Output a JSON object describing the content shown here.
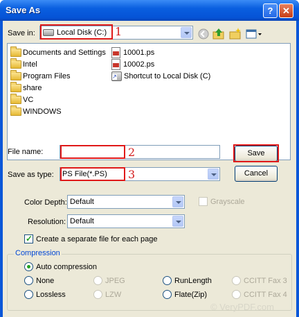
{
  "window": {
    "title": "Save As",
    "help_glyph": "?",
    "close_glyph": "✕"
  },
  "save_in": {
    "label": "Save in:",
    "value": "Local Disk (C:)",
    "annotation": "1"
  },
  "files": [
    {
      "name": "Documents and Settings",
      "icon": "folder-icon"
    },
    {
      "name": "Intel",
      "icon": "folder-icon"
    },
    {
      "name": "Program Files",
      "icon": "folder-icon"
    },
    {
      "name": "share",
      "icon": "folder-icon"
    },
    {
      "name": "VC",
      "icon": "folder-icon"
    },
    {
      "name": "WINDOWS",
      "icon": "folder-icon"
    },
    {
      "name": "10001.ps",
      "icon": "ps-file-icon"
    },
    {
      "name": "10002.ps",
      "icon": "ps-file-icon"
    },
    {
      "name": "Shortcut to Local Disk (C)",
      "icon": "shortcut-icon"
    }
  ],
  "file_name": {
    "label": "File name:",
    "value": "",
    "annotation": "2"
  },
  "save_as_type": {
    "label": "Save as type:",
    "value": "PS  File(*.PS)",
    "annotation": "3"
  },
  "buttons": {
    "save": "Save",
    "cancel": "Cancel"
  },
  "color_depth": {
    "label": "Color Depth:",
    "value": "Default"
  },
  "grayscale": {
    "label": "Grayscale",
    "checked": false,
    "enabled": false
  },
  "resolution": {
    "label": "Resolution:",
    "value": "Default"
  },
  "separate_file": {
    "label": "Create a separate file for each page",
    "checked": true
  },
  "compression": {
    "title": "Compression",
    "options": {
      "auto": "Auto compression",
      "none": "None",
      "lossless": "Lossless",
      "jpeg": "JPEG",
      "lzw": "LZW",
      "runlength": "RunLength",
      "flate": "Flate(Zip)",
      "ccitt3": "CCITT Fax 3",
      "ccitt4": "CCITT Fax 4"
    },
    "selected": "auto"
  },
  "watermark": "© VeryPDF.com",
  "colors": {
    "annotation_red": "#e01919",
    "title_blue": "#0a5fe0",
    "group_title": "#0046d5"
  }
}
